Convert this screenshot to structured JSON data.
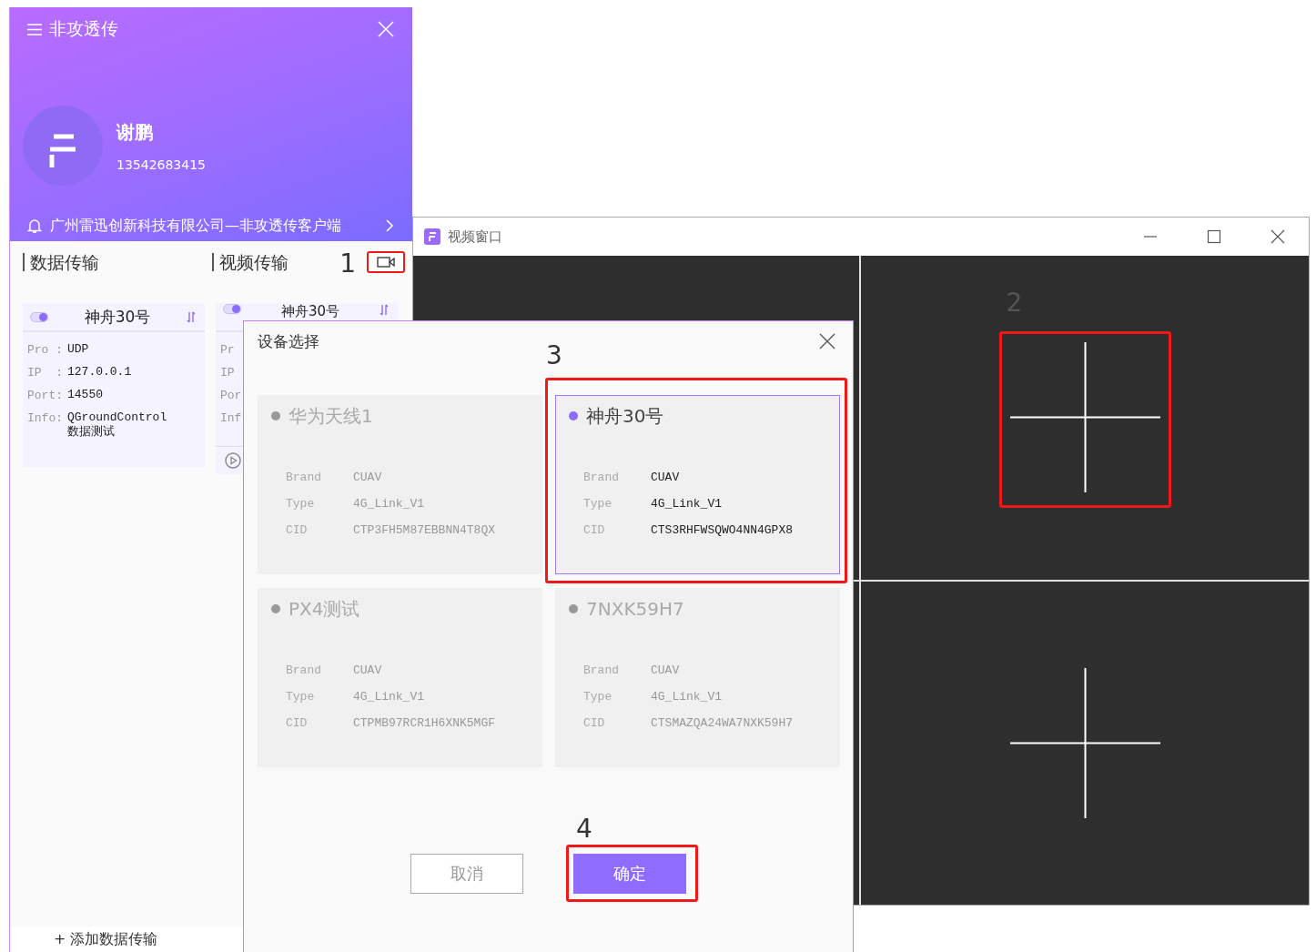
{
  "app_window": {
    "title": "非攻透传",
    "user": {
      "name": "谢鹏",
      "phone": "13542683415"
    },
    "notice": "广州雷迅创新科技有限公司—非攻透传客户端",
    "tabs": [
      {
        "label": "数据传输"
      },
      {
        "label": "视频传输"
      }
    ],
    "video_button": {
      "callout": "1"
    },
    "cards": [
      {
        "on": true,
        "title": "神舟30号",
        "playable": false,
        "fields": [
          {
            "label": "Pro :",
            "value": "UDP"
          },
          {
            "label": "IP  :",
            "value": "127.0.0.1"
          },
          {
            "label": "Port:",
            "value": "14550"
          },
          {
            "label": "Info:",
            "value": "QGroundControl数据测试"
          }
        ]
      },
      {
        "on": true,
        "title": "神舟30号",
        "playable": true,
        "fields": [
          {
            "label": "Pr"
          },
          {
            "label": "IP"
          },
          {
            "label": "Por"
          },
          {
            "label": "Inf"
          }
        ]
      }
    ],
    "add_link": "+ 添加数据传输"
  },
  "video_window": {
    "title": "视频窗口",
    "cells": [
      {
        "kind": "blank"
      },
      {
        "kind": "add",
        "callout": "2"
      },
      {
        "kind": "blank"
      },
      {
        "kind": "add"
      }
    ]
  },
  "device_dialog": {
    "title": "设备选择",
    "selection_callout": "3",
    "devices": [
      {
        "name": "华为天线1",
        "selected": false,
        "fields": [
          {
            "label": "Brand",
            "value": "CUAV"
          },
          {
            "label": "Type",
            "value": "4G_Link_V1"
          },
          {
            "label": "CID",
            "value": "CTP3FH5M87EBBNN4T8QX"
          }
        ]
      },
      {
        "name": "神舟30号",
        "selected": true,
        "fields": [
          {
            "label": "Brand",
            "value": "CUAV"
          },
          {
            "label": "Type",
            "value": "4G_Link_V1"
          },
          {
            "label": "CID",
            "value": "CTS3RHFWSQWO4NN4GPX8"
          }
        ]
      },
      {
        "name": "PX4测试",
        "selected": false,
        "fields": [
          {
            "label": "Brand",
            "value": "CUAV"
          },
          {
            "label": "Type",
            "value": "4G_Link_V1"
          },
          {
            "label": "CID",
            "value": "CTPMB97RCR1H6XNK5MGF"
          }
        ]
      },
      {
        "name": "7NXK59H7",
        "selected": false,
        "fields": [
          {
            "label": "Brand",
            "value": "CUAV"
          },
          {
            "label": "Type",
            "value": "4G_Link_V1"
          },
          {
            "label": "CID",
            "value": "CTSMAZQA24WA7NXK59H7"
          }
        ]
      }
    ],
    "buttons": [
      {
        "label": "取消",
        "kind": "secondary"
      },
      {
        "label": "确定",
        "kind": "primary",
        "callout": "4"
      }
    ]
  }
}
